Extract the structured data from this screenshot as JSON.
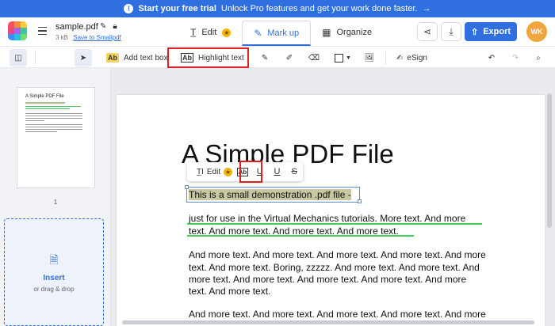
{
  "banner": {
    "bold": "Start your free trial",
    "text": "Unlock Pro features and get your work done faster.",
    "arrow": "→"
  },
  "header": {
    "filename": "sample.pdf",
    "filesize": "3 kB",
    "save_link": "Save to Smallpdf",
    "tabs": [
      {
        "label": "Edit",
        "icon": "text-edit-icon"
      },
      {
        "label": "Mark up",
        "icon": "pen-icon"
      },
      {
        "label": "Organize",
        "icon": "grid-icon"
      }
    ],
    "export_label": "Export",
    "avatar": "WK"
  },
  "toolbar": {
    "add_text_box": "Add text box",
    "add_text_badge": "Ab",
    "highlight_text": "Highlight text",
    "esign": "eSign"
  },
  "sidebar": {
    "page_number": "1",
    "insert_label": "Insert",
    "insert_sub": "or drag & drop",
    "thumb_title": "A Simple PDF File"
  },
  "document": {
    "title": "A Simple PDF File",
    "line1": "This is a small demonstration .pdf file -",
    "line2": "just for use in the Virtual Mechanics tutorials. More text. And more",
    "line3": "text. And more text. And more text. And more text.",
    "line4": "And more text. And more text. And more text. And more text. And more",
    "line5": "text. And more text. Boring, zzzzz. And more text. And more text. And",
    "line6": "more text. And more text. And more text. And more text. And more",
    "line7": "text. And more text.",
    "line8": "And more text. And more text. And more text. And more text. And more"
  },
  "floating_toolbar": {
    "edit_label": "Edit",
    "highlight_glyph": "Ab",
    "underline1": "U",
    "underline2": "U",
    "strike": "S"
  },
  "colors": {
    "accent": "#2f6fe0",
    "highlight": "#c7c7a2",
    "underline": "#3fcf5a",
    "callout": "#e02020",
    "pro_star": "#f4b400"
  }
}
